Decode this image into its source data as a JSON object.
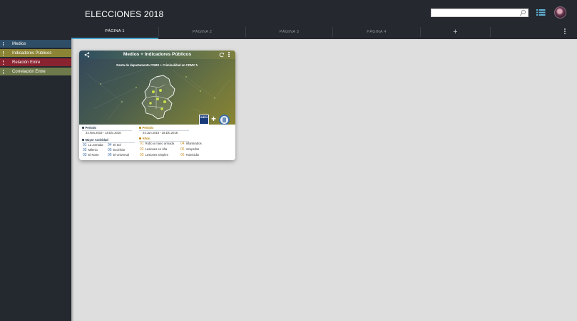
{
  "app": {
    "title": "ELECCIONES 2018"
  },
  "search": {
    "placeholder": ""
  },
  "tabs": [
    {
      "label": "PÁGINA 1",
      "active": true
    },
    {
      "label": "PÁGINA 2",
      "active": false
    },
    {
      "label": "PÁGINA 3",
      "active": false
    },
    {
      "label": "PÁGINA 4",
      "active": false
    }
  ],
  "tab_add_label": "+",
  "sidebar": {
    "items": [
      {
        "label": "Medios",
        "color": "#2e4d66"
      },
      {
        "label": "Indicadores Públicos",
        "color": "#8c8435"
      },
      {
        "label": "Relación Entre",
        "color": "#8a2330"
      },
      {
        "label": "Correlación Entre",
        "color": "#6f7a4c"
      }
    ]
  },
  "card": {
    "title": "Medios + Indicadores Públicos",
    "map_caption": "Renta de departamento CDMX + Criminalidad en CDMX",
    "inegi_label": "INEGI",
    "periodo_left": {
      "label": "Periodo",
      "value": "24.Nov.2016 - 18.Dic.2016"
    },
    "periodo_right": {
      "label": "Periodo",
      "value": "24.Jun.2016 - 18.Dic.2016"
    },
    "mayor_actividad": {
      "label": "Mayor Actividad",
      "items": [
        {
          "num": "01",
          "name": "La Jornada"
        },
        {
          "num": "02",
          "name": "Milenio"
        },
        {
          "num": "03",
          "name": "El Norte"
        },
        {
          "num": "04",
          "name": "El Sol"
        },
        {
          "num": "05",
          "name": "Excélsior"
        },
        {
          "num": "06",
          "name": "El Universal"
        }
      ]
    },
    "altos": {
      "label": "Altos",
      "items": [
        {
          "num": "01",
          "name": "Robo a mano armada"
        },
        {
          "num": "02",
          "name": "Lesiones en riña"
        },
        {
          "num": "03",
          "name": "Lesiones simples"
        },
        {
          "num": "04",
          "name": "Infanticidios"
        },
        {
          "num": "05",
          "name": "Atropellos"
        },
        {
          "num": "06",
          "name": "Homicidio"
        }
      ]
    }
  },
  "colors": {
    "topbar": "#25292f",
    "tab_active_underline": "#4aa3c9",
    "content_bg": "#dedede"
  },
  "icons": [
    "search-icon",
    "list-icon",
    "avatar",
    "plus-icon",
    "kebab-icon",
    "share-icon",
    "refresh-icon",
    "pencil-icon",
    "map-pin-icon",
    "document-icon"
  ]
}
